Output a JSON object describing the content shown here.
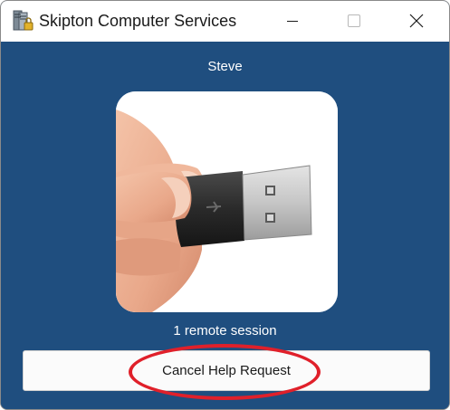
{
  "window": {
    "title": "Skipton Computer Services",
    "app_icon": "server-lock-icon",
    "controls": {
      "minimize_icon": "minimize-icon",
      "maximize_icon": "maximize-icon",
      "close_icon": "close-icon"
    }
  },
  "main": {
    "user_name": "Steve",
    "photo": "usb-drive-in-hand",
    "session_status": "1 remote session",
    "cancel_label": "Cancel Help Request"
  },
  "colors": {
    "background": "#1f4e7f",
    "annotation": "#e0202a"
  }
}
